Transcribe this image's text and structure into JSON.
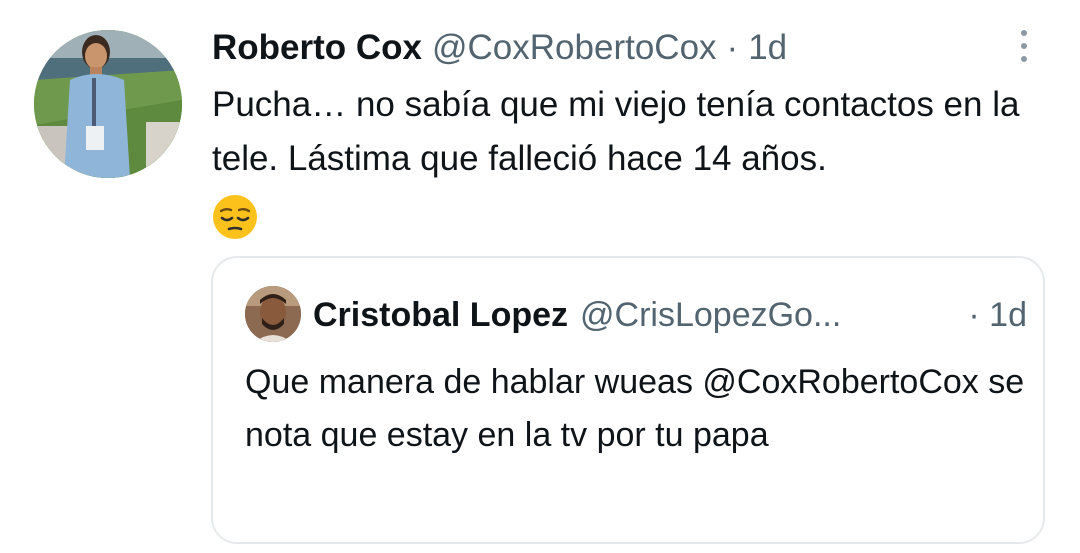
{
  "tweet": {
    "display_name": "Roberto Cox",
    "handle": "@CoxRobertoCox",
    "separator": "·",
    "time": "1d",
    "text": "Pucha… no sabía que mi viejo tenía contactos en la tele. Lástima que falleció hace 14 años.",
    "emoji": "pensive-face",
    "more_icon": "vertical-ellipsis-icon"
  },
  "quoted_tweet": {
    "display_name": "Cristobal Lopez",
    "handle": "@CrisLopezGo...",
    "time": "· 1d",
    "text": "Que manera de hablar wueas @CoxRobertoCox se nota que estay en la tv por tu papa"
  },
  "colors": {
    "text_primary": "#0f1419",
    "text_secondary": "#536471",
    "card_border": "#e6e9eb",
    "emoji_yellow": "#fcc21b"
  }
}
